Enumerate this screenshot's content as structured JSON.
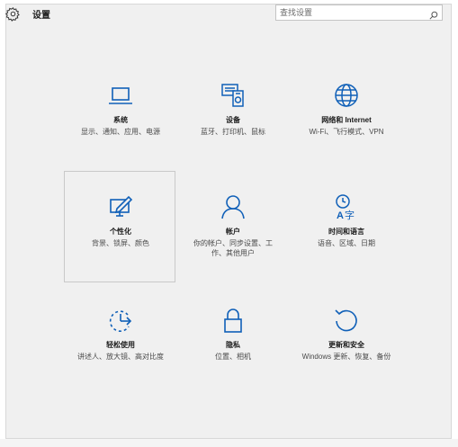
{
  "header": {
    "title": "设置",
    "icon": "gear-icon"
  },
  "search": {
    "placeholder": "查找设置",
    "value": "",
    "icon": "search-icon"
  },
  "accent_color": "#1060b8",
  "tiles": [
    {
      "id": "system",
      "name": "系统",
      "desc": "显示、通知、应用、电源",
      "icon": "laptop-icon"
    },
    {
      "id": "devices",
      "name": "设备",
      "desc": "蓝牙、打印机、鼠标",
      "icon": "devices-icon"
    },
    {
      "id": "network",
      "name": "网络和 Internet",
      "desc": "Wi-Fi、飞行模式、VPN",
      "icon": "globe-icon"
    },
    {
      "id": "personalization",
      "name": "个性化",
      "desc": "背景、锁屏、颜色",
      "icon": "personalization-icon"
    },
    {
      "id": "accounts",
      "name": "帐户",
      "desc": "你的帐户、同步设置、工作、其他用户",
      "icon": "person-icon"
    },
    {
      "id": "time-language",
      "name": "时间和语言",
      "desc": "语音、区域、日期",
      "icon": "time-language-icon"
    },
    {
      "id": "ease-of-access",
      "name": "轻松使用",
      "desc": "讲述人、放大镜、高对比度",
      "icon": "ease-of-access-icon"
    },
    {
      "id": "privacy",
      "name": "隐私",
      "desc": "位置、相机",
      "icon": "lock-icon"
    },
    {
      "id": "update-security",
      "name": "更新和安全",
      "desc": "Windows 更新、恢复、备份",
      "icon": "update-icon"
    }
  ]
}
